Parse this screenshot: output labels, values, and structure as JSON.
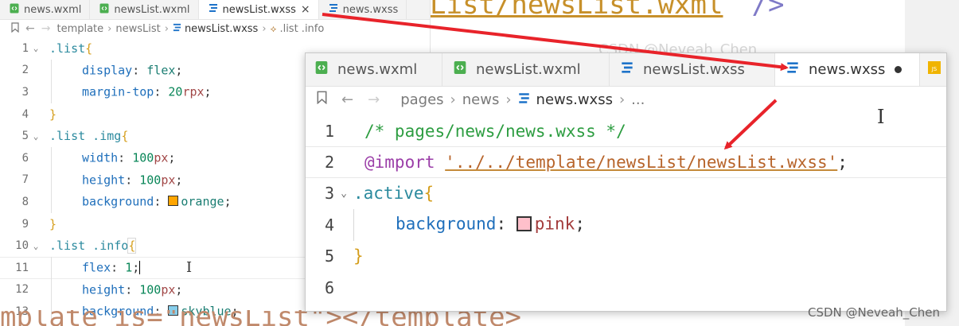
{
  "background_file": {
    "top_text": "List/newsList.wxml",
    "top_close": "/>",
    "bottom_text": "mplate is=\"newsList\"></template>",
    "faint_watermark": "CSDN @Neveah_Chen"
  },
  "left_editor": {
    "tabs": [
      {
        "label": "news.wxml",
        "icon": "wxml-file-icon",
        "active": false
      },
      {
        "label": "newsList.wxml",
        "icon": "wxml-file-icon",
        "active": false
      },
      {
        "label": "newsList.wxss",
        "icon": "wxss-file-icon",
        "active": true,
        "close": "×"
      },
      {
        "label": "news.wxss",
        "icon": "wxss-file-icon",
        "active": false
      }
    ],
    "breadcrumb": {
      "items": [
        "template",
        "newsList",
        "newsList.wxss",
        ".list .info"
      ]
    },
    "lines": [
      {
        "num": "1",
        "fold": true
      },
      {
        "num": "2"
      },
      {
        "num": "3"
      },
      {
        "num": "4"
      },
      {
        "num": "5",
        "fold": true
      },
      {
        "num": "6"
      },
      {
        "num": "7"
      },
      {
        "num": "8"
      },
      {
        "num": "9"
      },
      {
        "num": "10",
        "fold": true
      },
      {
        "num": "11"
      },
      {
        "num": "12"
      },
      {
        "num": "13"
      }
    ],
    "code": {
      "l1_sel": ".list",
      "l2_prop": "display",
      "l2_val": "flex",
      "l3_prop": "margin-top",
      "l3_num": "20",
      "l3_unit": "rpx",
      "l5_sel": ".list .img",
      "l6_prop": "width",
      "l6_num": "100",
      "l6_unit": "px",
      "l7_prop": "height",
      "l7_num": "100",
      "l7_unit": "px",
      "l8_prop": "background",
      "l8_val": "orange",
      "l10_sel": ".list .info",
      "l11_prop": "flex",
      "l11_num": "1",
      "l12_prop": "height",
      "l12_num": "100",
      "l12_unit": "px",
      "l13_prop": "background",
      "l13_val": "skyblue"
    },
    "colors": {
      "orange": "#ffa500",
      "skyblue": "#87ceeb"
    }
  },
  "overlay_editor": {
    "tabs": [
      {
        "label": "news.wxml",
        "icon": "wxml-file-icon",
        "active": false
      },
      {
        "label": "newsList.wxml",
        "icon": "wxml-file-icon",
        "active": false
      },
      {
        "label": "newsList.wxss",
        "icon": "wxss-file-icon",
        "active": false
      },
      {
        "label": "news.wxss",
        "icon": "wxss-file-icon",
        "active": true,
        "dirty": true
      },
      {
        "label": "",
        "icon": "js-file-icon",
        "active": false
      }
    ],
    "breadcrumb": {
      "items": [
        "pages",
        "news",
        "news.wxss",
        "..."
      ]
    },
    "lines": [
      {
        "num": "1"
      },
      {
        "num": "2"
      },
      {
        "num": "3",
        "fold": true
      },
      {
        "num": "4"
      },
      {
        "num": "5"
      },
      {
        "num": "6"
      }
    ],
    "code": {
      "l1_comment": "/* pages/news/news.wxss */",
      "l2_at": "@import",
      "l2_str": "'../../template/newsList/newsList.wxss'",
      "l3_sel": ".active",
      "l4_prop": "background",
      "l4_val": "pink"
    },
    "colors": {
      "pink": "#ffc0cb"
    }
  },
  "watermark": "CSDN @Neveah_Chen",
  "annotation_color": "#e8232a"
}
